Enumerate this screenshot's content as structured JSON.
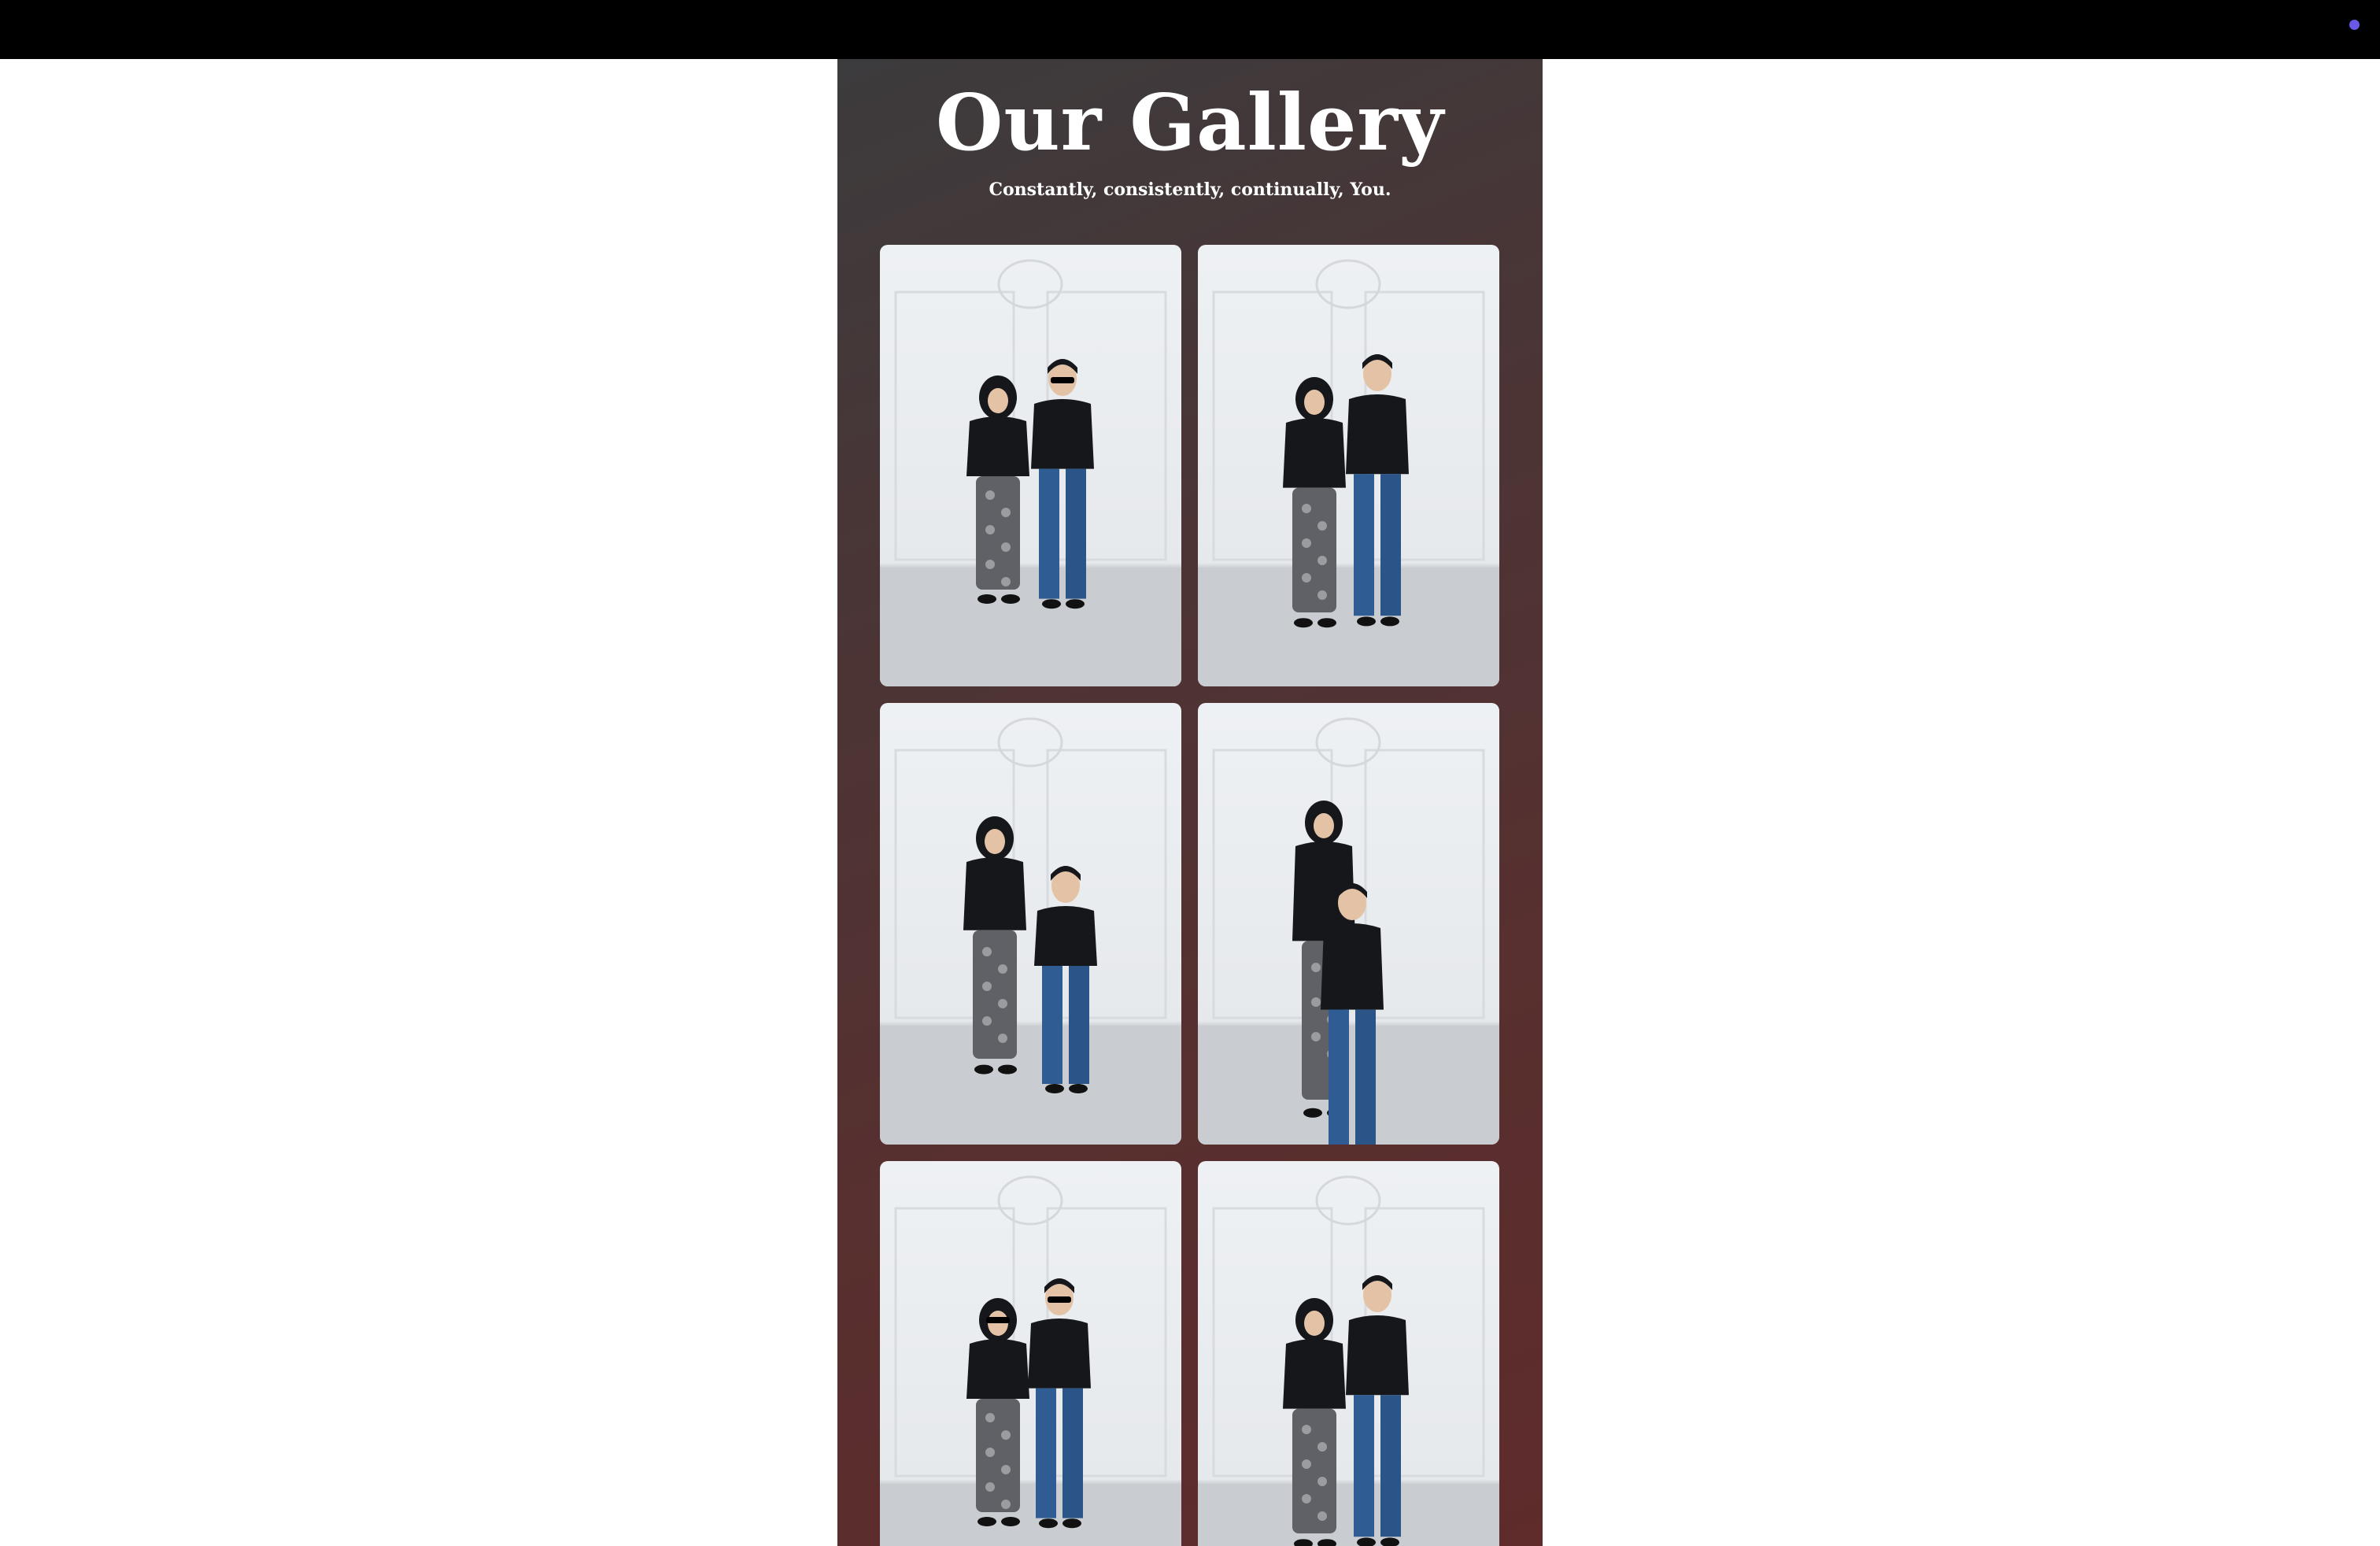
{
  "header": {
    "status_dot_color": "#6a58e6"
  },
  "gallery": {
    "title": "Our Gallery",
    "subtitle": "Constantly, consistently, continually, You.",
    "photos": [
      {
        "icon": "photo-couple-standing-sunglasses"
      },
      {
        "icon": "photo-couple-standing"
      },
      {
        "icon": "photo-couple-seated"
      },
      {
        "icon": "photo-couple-closeup"
      },
      {
        "icon": "photo-couple-standing-sunglasses"
      },
      {
        "icon": "photo-couple-standing"
      }
    ]
  },
  "colors": {
    "panel_top": "#3c3b3d",
    "panel_bottom": "#5f2b2b",
    "topbar": "#000000"
  }
}
